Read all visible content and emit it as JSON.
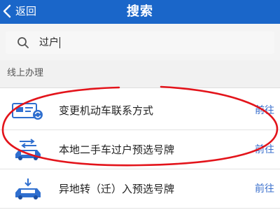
{
  "header": {
    "back_label": "返回",
    "title": "搜索"
  },
  "search": {
    "query": "过户"
  },
  "section": {
    "title": "线上办理"
  },
  "results": [
    {
      "name": "变更机动车联系方式",
      "action": "前往"
    },
    {
      "name": "本地二手车过户预选号牌",
      "action": "前往"
    },
    {
      "name": "异地转（迁）入预选号牌",
      "action": "前往"
    }
  ],
  "colors": {
    "header_bg": "#1a66c9",
    "action_link": "#3a6fcc",
    "highlight_oval": "#e3141b"
  }
}
